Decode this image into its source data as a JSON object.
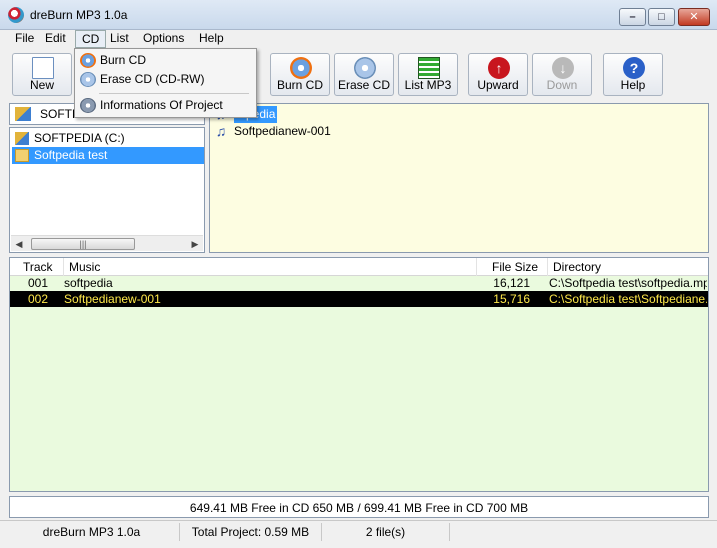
{
  "window": {
    "title": "dreBurn MP3 1.0a"
  },
  "menubar": {
    "items": [
      "File",
      "Edit",
      "CD",
      "List",
      "Options",
      "Help"
    ]
  },
  "cd_menu": {
    "items": [
      {
        "label": "Burn CD",
        "icon": "burn-cd-icon"
      },
      {
        "label": "Erase CD (CD-RW)",
        "icon": "erase-cd-icon"
      },
      {
        "label": "Informations Of Project",
        "icon": "project-info-icon"
      }
    ]
  },
  "toolbar": {
    "new_label": "New",
    "burn_label": "Burn CD",
    "erase_label": "Erase CD",
    "list_label": "List MP3",
    "upward_label": "Upward",
    "down_label": "Down",
    "help_label": "Help"
  },
  "drive_selector": {
    "value": "SOFTP"
  },
  "folder_tree": {
    "items": [
      {
        "label": "SOFTPEDIA (C:)"
      },
      {
        "label": "Softpedia test"
      }
    ]
  },
  "file_list": {
    "items": [
      {
        "label": "...pedia"
      },
      {
        "label": "Softpedianew-001"
      }
    ]
  },
  "track_table": {
    "columns": [
      "Track",
      "Music",
      "File Size",
      "Directory"
    ],
    "rows": [
      {
        "track": "001",
        "music": "softpedia",
        "size": "16,121",
        "directory": "C:\\Softpedia test\\softpedia.mp3"
      },
      {
        "track": "002",
        "music": "Softpedianew-001",
        "size": "15,716",
        "directory": "C:\\Softpedia test\\Softpediane..."
      }
    ]
  },
  "free_space": "649.41 MB Free in CD 650 MB / 699.41 MB Free in CD 700 MB",
  "statusbar": {
    "app": "dreBurn MP3 1.0a",
    "total": "Total Project: 0.59 MB",
    "files": "2 file(s)"
  },
  "colors": {
    "selection": "#3399ff",
    "table_bg": "#eafade",
    "file_panel_bg": "#fdfde1",
    "selected_row_bg": "#000000",
    "selected_row_text": "#ffe94a"
  }
}
